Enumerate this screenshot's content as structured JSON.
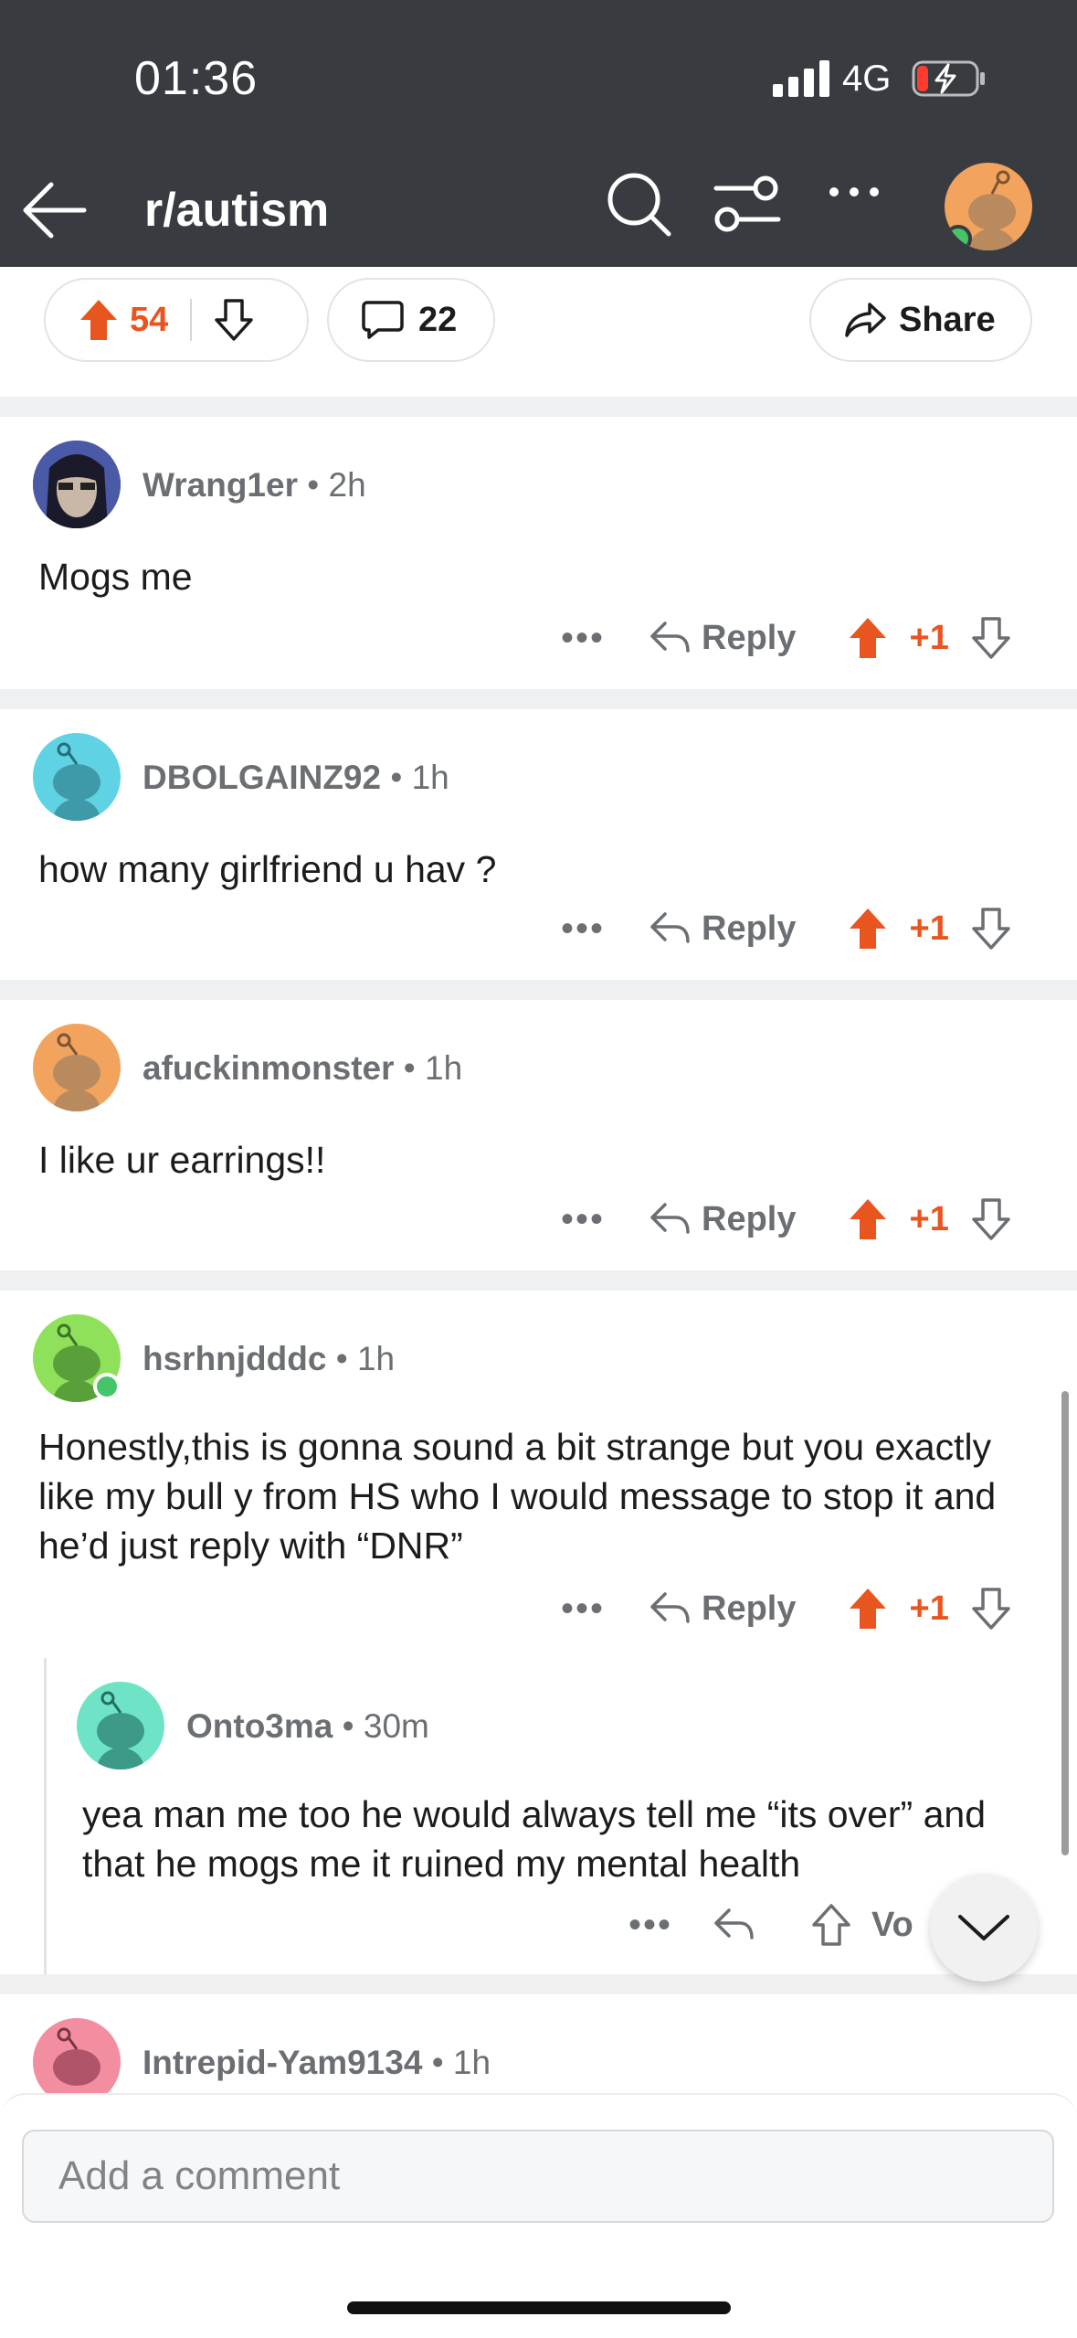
{
  "status_bar": {
    "time": "01:36",
    "network": "4G"
  },
  "nav": {
    "subreddit": "r/autism"
  },
  "post_actions": {
    "upvotes": "54",
    "comments": "22",
    "share_label": "Share"
  },
  "colors": {
    "topbar": "#383c41",
    "upvote": "#e8551f",
    "online": "#46c46a"
  },
  "comments": [
    {
      "user": "Wrang1er",
      "time": "2h",
      "text": "Mogs me",
      "reply_label": "Reply",
      "score": "+1",
      "avatar": "anime-avatar"
    },
    {
      "user": "DBOLGAINZ92",
      "time": "1h",
      "text": "how many girlfriend u hav ?",
      "reply_label": "Reply",
      "score": "+1",
      "avatar": "snoo-cyan"
    },
    {
      "user": "afuckinmonster",
      "time": "1h",
      "text": "I like ur earrings!!",
      "reply_label": "Reply",
      "score": "+1",
      "avatar": "snoo-orange"
    },
    {
      "user": "hsrhnjdddc",
      "time": "1h",
      "text": "Honestly,this is gonna sound a bit strange but you exactly like my bull y from HS who I would message to stop it and he’d just reply with “DNR”",
      "reply_label": "Reply",
      "score": "+1",
      "avatar": "snoo-green"
    }
  ],
  "reply": {
    "user": "Onto3ma",
    "time": "30m",
    "text": "yea man me too he would always tell me “its over” and that he mogs me it ruined my mental health",
    "vote_label": "Vo",
    "avatar": "snoo-teal"
  },
  "next_comment": {
    "user": "Intrepid-Yam9134",
    "time": "1h",
    "avatar": "snoo-pink"
  },
  "composer": {
    "placeholder": "Add a comment"
  }
}
